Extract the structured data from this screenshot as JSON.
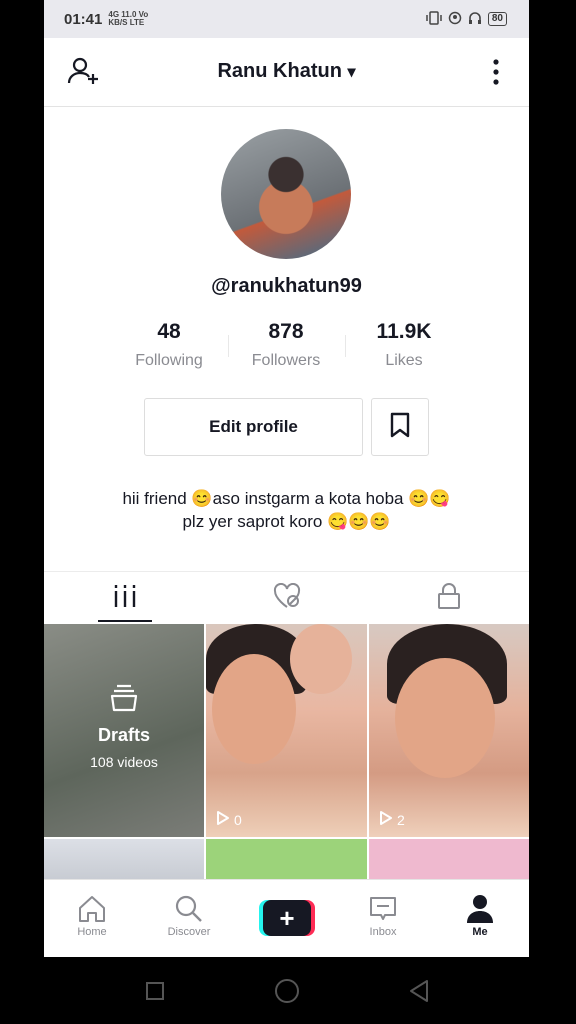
{
  "status": {
    "time": "01:41",
    "net_line1": "4G 11.0 Vo",
    "net_line2": "KB/S LTE",
    "battery": "80"
  },
  "header": {
    "title": "Ranu Khatun",
    "caret": "▾"
  },
  "profile": {
    "handle": "@ranukhatun99"
  },
  "stats": [
    {
      "value": "48",
      "label": "Following"
    },
    {
      "value": "878",
      "label": "Followers"
    },
    {
      "value": "11.9K",
      "label": "Likes"
    }
  ],
  "actions": {
    "edit_label": "Edit profile"
  },
  "bio": {
    "line1": "hii friend 😊aso instgarm a kota hoba 😊😋",
    "line2": "plz yer saprot koro 😋😊😊"
  },
  "grid": {
    "drafts_label": "Drafts",
    "drafts_count": "108 videos",
    "videos": [
      {
        "views": "0"
      },
      {
        "views": "2"
      }
    ]
  },
  "nav": [
    {
      "label": "Home",
      "icon": "home-icon"
    },
    {
      "label": "Discover",
      "icon": "search-icon"
    },
    {
      "label": "",
      "icon": "plus-icon"
    },
    {
      "label": "Inbox",
      "icon": "inbox-icon"
    },
    {
      "label": "Me",
      "icon": "person-icon"
    }
  ],
  "colors": {
    "accent_cyan": "#25f4ee",
    "accent_red": "#fe2c55",
    "text": "#161823",
    "muted": "#8a8b91"
  }
}
